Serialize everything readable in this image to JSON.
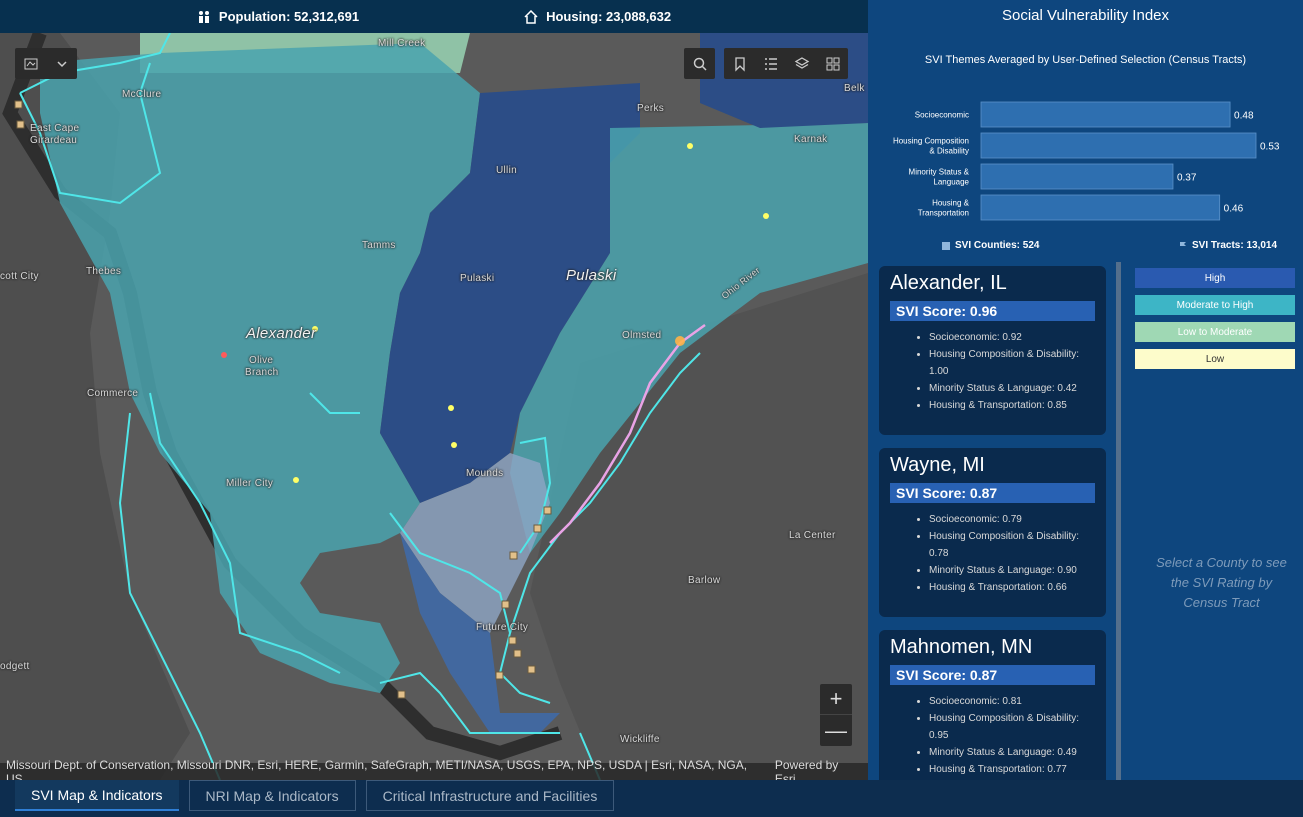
{
  "header": {
    "population": "Population: 52,312,691",
    "housing": "Housing: 23,088,632"
  },
  "map": {
    "labels": {
      "mill_creek": "Mill Creek",
      "mcclure": "McClure",
      "east_cape": "East Cape",
      "girardeau": "Girardeau",
      "perks": "Perks",
      "belk": "Belk",
      "karnak": "Karnak",
      "ullin": "Ullin",
      "tamms": "Tamms",
      "thebes": "Thebes",
      "scott_city": "cott City",
      "pulaski_town": "Pulaski",
      "pulaski_county": "Pulaski",
      "alexander": "Alexander",
      "olive": "Olive",
      "branch": "Branch",
      "olmsted": "Olmsted",
      "ohio_river": "Ohio River",
      "commerce": "Commerce",
      "mounds": "Mounds",
      "miller_city": "Miller City",
      "la_center": "La Center",
      "barlow": "Barlow",
      "future_city": "Future City",
      "wickliffe": "Wickliffe",
      "bodgett": "odgett"
    },
    "attribution": "Missouri Dept. of Conservation, Missouri DNR, Esri, HERE, Garmin, SafeGraph, METI/NASA, USGS, EPA, NPS, USDA | Esri, NASA, NGA, US...",
    "powered": "Powered by Esri",
    "zoom_in": "+",
    "zoom_out": "—"
  },
  "sidebar": {
    "title": "Social Vulnerability Index",
    "chart_title": "SVI Themes Averaged by User-Defined Selection (Census Tracts)",
    "counties": "SVI Counties: 524",
    "tracts": "SVI Tracts: 13,014",
    "hint": "Select a County to see the SVI Rating by Census Tract"
  },
  "chart_data": {
    "type": "bar",
    "orientation": "horizontal",
    "categories": [
      "Socioeconomic",
      "Housing Composition & Disability",
      "Minority Status & Language",
      "Housing & Transportation"
    ],
    "values": [
      0.48,
      0.53,
      0.37,
      0.46
    ],
    "title": "SVI Themes Averaged by User-Defined Selection (Census Tracts)",
    "bar_color": "#2e6fb0"
  },
  "cards": [
    {
      "name": "Alexander, IL",
      "score": "SVI Score: 0.96",
      "items": [
        "Socioeconomic: 0.92",
        "Housing Composition & Disability: 1.00",
        "Minority Status & Language: 0.42",
        "Housing & Transportation: 0.85"
      ]
    },
    {
      "name": "Wayne, MI",
      "score": "SVI Score: 0.87",
      "items": [
        "Socioeconomic: 0.79",
        "Housing Composition & Disability: 0.78",
        "Minority Status & Language: 0.90",
        "Housing & Transportation: 0.66"
      ]
    },
    {
      "name": "Mahnomen, MN",
      "score": "SVI Score: 0.87",
      "items": [
        "Socioeconomic: 0.81",
        "Housing Composition & Disability: 0.95",
        "Minority Status & Language: 0.49",
        "Housing & Transportation: 0.77"
      ]
    }
  ],
  "legend": [
    {
      "label": "High",
      "color": "#2a5ab0",
      "text": "#ffffff"
    },
    {
      "label": "Moderate to High",
      "color": "#3db5c6",
      "text": "#ffffff"
    },
    {
      "label": "Low to Moderate",
      "color": "#9fd8b4",
      "text": "#ffffff"
    },
    {
      "label": "Low",
      "color": "#fdfccb",
      "text": "#333333"
    }
  ],
  "tabs": [
    {
      "label": "SVI Map & Indicators",
      "active": true
    },
    {
      "label": "NRI Map & Indicators",
      "active": false
    },
    {
      "label": "Critical Infrastructure and Facilities",
      "active": false
    }
  ]
}
